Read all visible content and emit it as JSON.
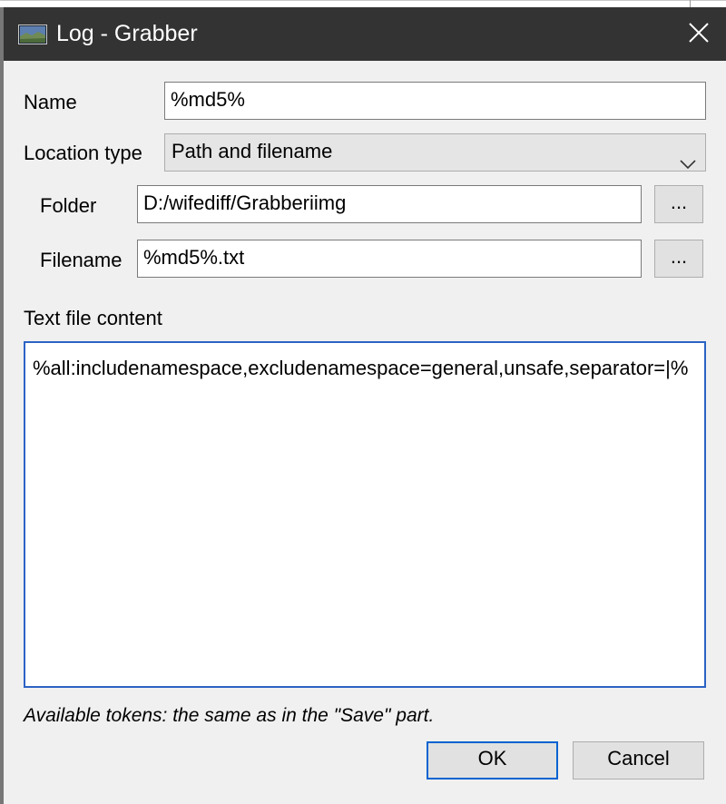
{
  "window": {
    "title": "Log - Grabber",
    "icon": "image-icon",
    "close_icon": "close-icon"
  },
  "form": {
    "name_label": "Name",
    "name_value": "%md5%",
    "location_type_label": "Location type",
    "location_type_value": "Path and filename",
    "folder_label": "Folder",
    "folder_value": "D:/wifediff/Grabberiimg",
    "folder_browse": "...",
    "filename_label": "Filename",
    "filename_value": "%md5%.txt",
    "filename_browse": "...",
    "content_label": "Text file content",
    "content_value": "%all:includenamespace,excludenamespace=general,unsafe,separator=|%",
    "hint": "Available tokens: the same as in the \"Save\" part."
  },
  "buttons": {
    "ok": "OK",
    "cancel": "Cancel"
  },
  "colors": {
    "titlebar": "#333333",
    "client": "#f0f0f0",
    "focus_border": "#2b63c4",
    "default_button_border": "#0063d1"
  }
}
